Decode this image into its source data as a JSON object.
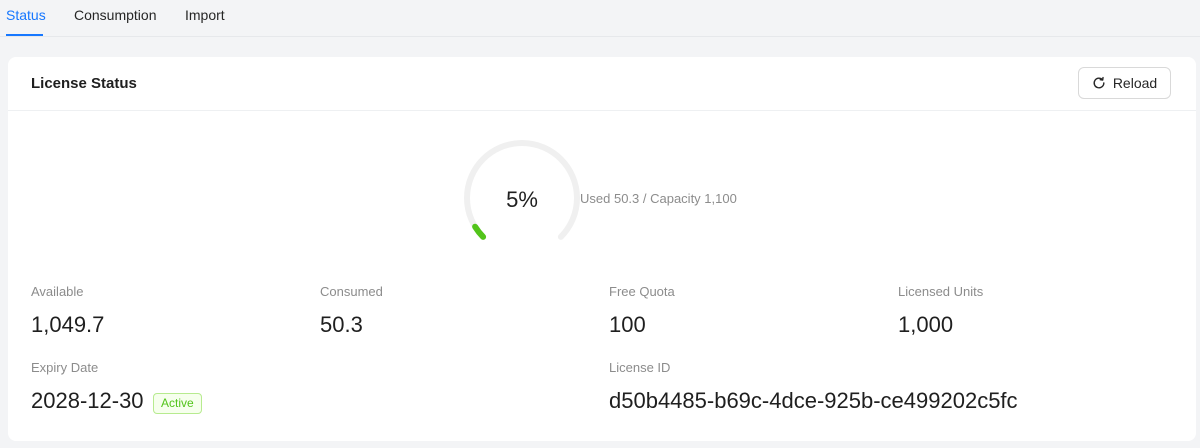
{
  "tabs": [
    "Status",
    "Consumption",
    "Import"
  ],
  "card": {
    "title": "License Status",
    "reload_label": "Reload"
  },
  "gauge": {
    "percent_text": "5%",
    "percent_value": 5,
    "caption": "Used 50.3 / Capacity 1,100",
    "color_fill": "#52c41a",
    "color_track": "#f0f0f0"
  },
  "stats": {
    "available": {
      "label": "Available",
      "value": "1,049.7"
    },
    "consumed": {
      "label": "Consumed",
      "value": "50.3"
    },
    "free_quota": {
      "label": "Free Quota",
      "value": "100"
    },
    "licensed_units": {
      "label": "Licensed Units",
      "value": "1,000"
    },
    "expiry_date": {
      "label": "Expiry Date",
      "value": "2028-12-30",
      "badge": "Active"
    },
    "license_id": {
      "label": "License ID",
      "value": "d50b4485-b69c-4dce-925b-ce499202c5fc"
    }
  },
  "colors": {
    "accent": "#1677ff",
    "success": "#52c41a"
  }
}
